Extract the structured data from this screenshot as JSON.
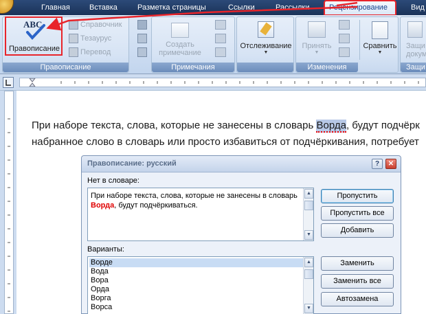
{
  "tabs": [
    {
      "label": "Главная",
      "active": false
    },
    {
      "label": "Вставка",
      "active": false
    },
    {
      "label": "Разметка страницы",
      "active": false
    },
    {
      "label": "Ссылки",
      "active": false
    },
    {
      "label": "Рассылки",
      "active": false
    },
    {
      "label": "Рецензирование",
      "active": true
    },
    {
      "label": "Вид",
      "active": false
    }
  ],
  "ribbon": {
    "spelling_group": {
      "label": "Правописание",
      "spelling_button": "Правописание",
      "spelling_icon_text": "ABC",
      "reference": "Справочник",
      "thesaurus": "Тезаурус",
      "translate": "Перевод"
    },
    "notes_group": {
      "label": "Примечания",
      "create_note_line1": "Создать",
      "create_note_line2": "примечание"
    },
    "tracking": {
      "label": "Отслеживание"
    },
    "changes_group": {
      "label": "Изменения",
      "accept": "Принять",
      "compare": "Сравнить"
    },
    "protect_group": {
      "label_partial": "Защи",
      "button_line1": "Защи",
      "button_line2": "докум"
    }
  },
  "document": {
    "line1_before": "При наборе текста, слова, которые не занесены в словарь ",
    "line1_word": "Ворда",
    "line1_after": ", будут подчёрк",
    "line2": "набранное слово в словарь или просто избавиться от подчёркивания, потребует"
  },
  "dialog": {
    "title": "Правописание: русский",
    "help_icon": "?",
    "close_icon": "✕",
    "not_in_dict_label": "Нет в словаре:",
    "text_before": "При наборе текста, слова, которые не занесены в словарь",
    "text_error": "Ворда",
    "text_after": ", будут подчёркиваться.",
    "suggestions_label": "Варианты:",
    "suggestions": [
      "Ворде",
      "Вода",
      "Вора",
      "Орда",
      "Ворга",
      "Ворса"
    ],
    "buttons": {
      "skip": "Пропустить",
      "skip_all": "Пропустить все",
      "add": "Добавить",
      "replace": "Заменить",
      "replace_all": "Заменить все",
      "autocorrect": "Автозамена"
    }
  },
  "colors": {
    "annotation": "#e8242a",
    "ribbon": "#d6e3f4",
    "tabbar": "#1a3258"
  }
}
